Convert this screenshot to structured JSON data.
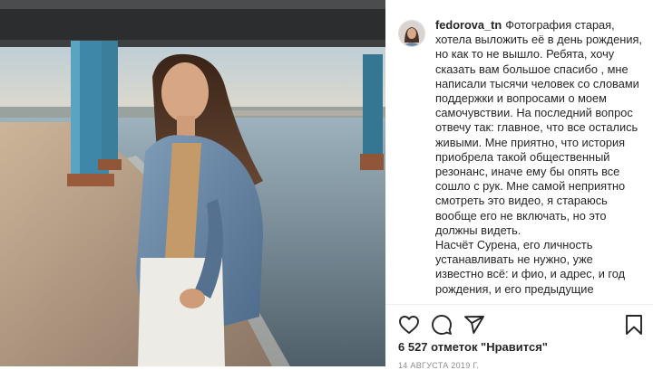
{
  "post": {
    "username": "fedorova_tn",
    "caption_paragraphs": [
      "Фотография старая, хотела выложить её в день рождения, но как то не вышло. Ребята, хочу сказать вам большое спасибо , мне написали тысячи человек со словами поддержки и вопросами о моем самочувствии. На последний вопрос отвечу так: главное, что все остались живыми. Мне приятно, что история приобрела такой общественный резонанс, иначе ему бы опять все сошло с рук. Мне самой неприятно смотреть это видео, я стараюсь вообще его не включать, но это должны видеть.",
      "Насчёт Сурена, его личность устанавливать не нужно, уже известно всё: и фио, и адрес, и год рождения, и его предыдущие"
    ],
    "likes": "6 527 отметок \"Нравится\"",
    "date": "14 АВГУСТА 2019 Г."
  },
  "icons": {
    "like": "heart-icon",
    "comment": "comment-icon",
    "share": "share-icon",
    "save": "bookmark-icon"
  },
  "colors": {
    "text": "#262626",
    "muted": "#8e8e8e",
    "divider": "#efefef"
  }
}
